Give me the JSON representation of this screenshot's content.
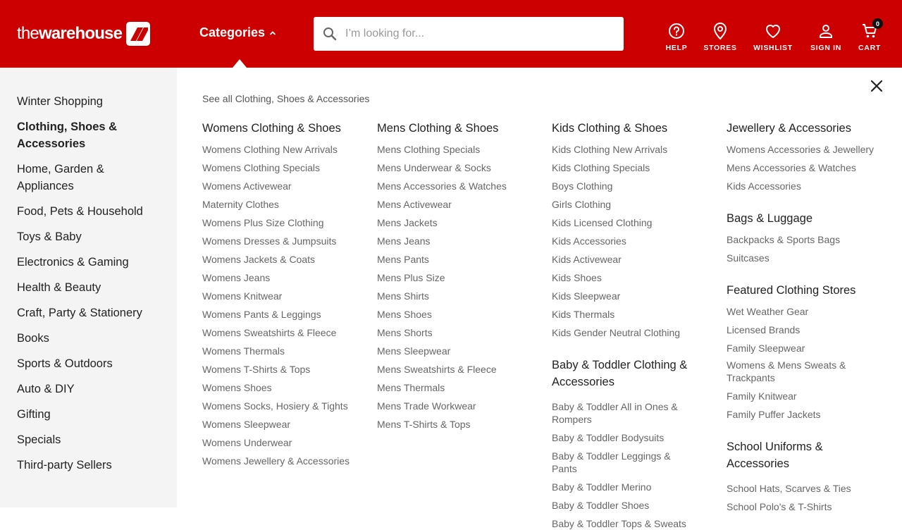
{
  "brand": {
    "logo_the": "the",
    "logo_warehouse": "warehouse",
    "accent": "#cc0000"
  },
  "header": {
    "categories_label": "Categories",
    "search_placeholder": "I’m looking for...",
    "nav": {
      "help": "HELP",
      "stores": "STORES",
      "wishlist": "WISHLIST",
      "sign_in": "SIGN IN",
      "cart": "CART",
      "cart_count": "0"
    }
  },
  "sidebar": {
    "items": [
      "Winter Shopping",
      "Clothing, Shoes & Accessories",
      "Home, Garden & Appliances",
      "Food, Pets & Household",
      "Toys & Baby",
      "Electronics & Gaming",
      "Health & Beauty",
      "Craft, Party & Stationery",
      "Books",
      "Sports & Outdoors",
      "Auto & DIY",
      "Gifting",
      "Specials",
      "Third-party Sellers"
    ]
  },
  "menu": {
    "see_all": "See all Clothing, Shoes & Accessories",
    "womens": {
      "title": "Womens Clothing & Shoes",
      "links": [
        "Womens Clothing New Arrivals",
        "Womens Clothing Specials",
        "Womens Activewear",
        "Maternity Clothes",
        "Womens Plus Size Clothing",
        "Womens Dresses & Jumpsuits",
        "Womens Jackets & Coats",
        "Womens Jeans",
        "Womens Knitwear",
        "Womens Pants & Leggings",
        "Womens Sweatshirts & Fleece",
        "Womens Thermals",
        "Womens T-Shirts & Tops",
        "Womens Shoes",
        "Womens Socks, Hosiery & Tights",
        "Womens Sleepwear",
        "Womens Underwear",
        "Womens Jewellery & Accessories"
      ]
    },
    "mens": {
      "title": "Mens Clothing & Shoes",
      "links": [
        "Mens Clothing Specials",
        "Mens Underwear & Socks",
        "Mens Accessories & Watches",
        "Mens Activewear",
        "Mens Jackets",
        "Mens Jeans",
        "Mens Pants",
        "Mens Plus Size",
        "Mens Shirts",
        "Mens Shoes",
        "Mens Shorts",
        "Mens Sleepwear",
        "Mens Sweatshirts & Fleece",
        "Mens Thermals",
        "Mens Trade Workwear",
        "Mens T-Shirts & Tops"
      ]
    },
    "kids": {
      "title": "Kids Clothing & Shoes",
      "links": [
        "Kids Clothing New Arrivals",
        "Kids Clothing Specials",
        "Boys Clothing",
        "Girls Clothing",
        "Kids Licensed Clothing",
        "Kids Accessories",
        "Kids Activewear",
        "Kids Shoes",
        "Kids Sleepwear",
        "Kids Thermals",
        "Kids Gender Neutral Clothing"
      ]
    },
    "baby": {
      "title": "Baby & Toddler Clothing & Accessories",
      "links": [
        "Baby & Toddler All in Ones & Rompers",
        "Baby & Toddler Bodysuits",
        "Baby & Toddler Leggings & Pants",
        "Baby & Toddler Merino",
        "Baby & Toddler Shoes",
        "Baby & Toddler Tops & Sweats"
      ]
    },
    "jewellery": {
      "title": "Jewellery & Accessories",
      "links": [
        "Womens Accessories & Jewellery",
        "Mens Accessories & Watches",
        "Kids Accessories"
      ]
    },
    "bags": {
      "title": "Bags & Luggage",
      "links": [
        "Backpacks & Sports Bags",
        "Suitcases"
      ]
    },
    "featured": {
      "title": "Featured Clothing Stores",
      "links": [
        "Wet Weather Gear",
        "Licensed Brands",
        "Family Sleepwear",
        "Womens & Mens Sweats & Trackpants",
        "Family Knitwear",
        "Family Puffer Jackets"
      ]
    },
    "school": {
      "title": "School Uniforms & Accessories",
      "links": [
        "School Hats, Scarves & Ties",
        "School Polo's & T-Shirts"
      ]
    }
  },
  "icons": {
    "search": "search-icon",
    "help": "help-icon",
    "stores": "map-pin-icon",
    "wishlist": "heart-icon",
    "sign_in": "user-icon",
    "cart": "cart-icon",
    "close": "close-icon",
    "chevron": "chevron-up-icon"
  }
}
